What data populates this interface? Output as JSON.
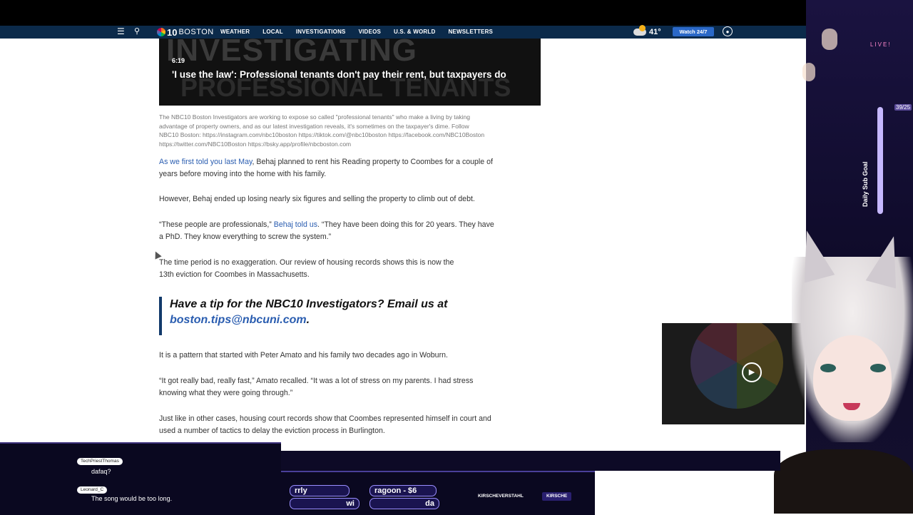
{
  "nav": {
    "logo_num": "10",
    "logo_text": "BOSTON",
    "links": [
      "WEATHER",
      "LOCAL",
      "INVESTIGATIONS",
      "VIDEOS",
      "U.S. & WORLD",
      "NEWSLETTERS"
    ],
    "temperature": "41°",
    "watch_label": "Watch 24/7"
  },
  "video": {
    "bg_line1": "INVESTIGATING",
    "bg_line2": "PROFESSIONAL TENANTS",
    "duration": "6:19",
    "title": "'I use the law': Professional tenants don't pay their rent, but taxpayers do"
  },
  "caption": "The NBC10 Boston Investigators are working to expose so called \"professional tenants\" who make a living by taking advantage of property owners, and as our latest investigation reveals, it's sometimes on the taxpayer's dime. Follow NBC10 Boston: https://instagram.com/nbc10boston https://tiktok.com/@nbc10boston https://facebook.com/NBC10Boston https://twitter.com/NBC10Boston https://bsky.app/profile/nbcboston.com",
  "article": {
    "p1_link": "As we first told you last May",
    "p1_rest": ", Behaj planned to rent his Reading property to Coombes for a couple of years before moving into the home with his family.",
    "p2": "However, Behaj ended up losing nearly six figures and selling the property to climb out of debt.",
    "p3_start": "“These people are professionals,” ",
    "p3_link": "Behaj told us",
    "p3_rest": ". “They have been doing this for 20 years. They have a PhD. They know everything to screw the system.”",
    "p4": "The time period is no exaggeration. Our review of housing records shows this is now the 13th eviction for Coombes in Massachusetts.",
    "tip_text": "Have a tip for the NBC10 Investigators? Email us at ",
    "tip_email": "boston.tips@nbcuni.com",
    "tip_end": ".",
    "p5": "It is a pattern that started with Peter Amato and his family two decades ago in Woburn.",
    "p6": "“It got really bad, really fast,” Amato recalled. “It was a lot of stress on my parents. I had stress knowing what they were going through.”",
    "p7": "Just like in other cases, housing court records show that Coombes represented himself in court and used a number of tactics to delay the eviction process in Burlington."
  },
  "stream": {
    "live_label": "LIVE!",
    "goal_label": "Daily Sub Goal",
    "goal_count": "39/25",
    "chat": [
      {
        "user": "TechPriestThomas",
        "message": "dafaq?"
      },
      {
        "user": "Leonard_C",
        "message": "The song would be too long."
      }
    ],
    "ticker": [
      "rrly",
      "ragoon - $6",
      "wi",
      "da"
    ],
    "socials": [
      "KIRSCHEVERSTAHL",
      "KIRSCHE"
    ]
  },
  "colors": {
    "nav_bg": "#0b2a4a",
    "link": "#2a5db0",
    "stream_bg": "#0d0a26"
  }
}
